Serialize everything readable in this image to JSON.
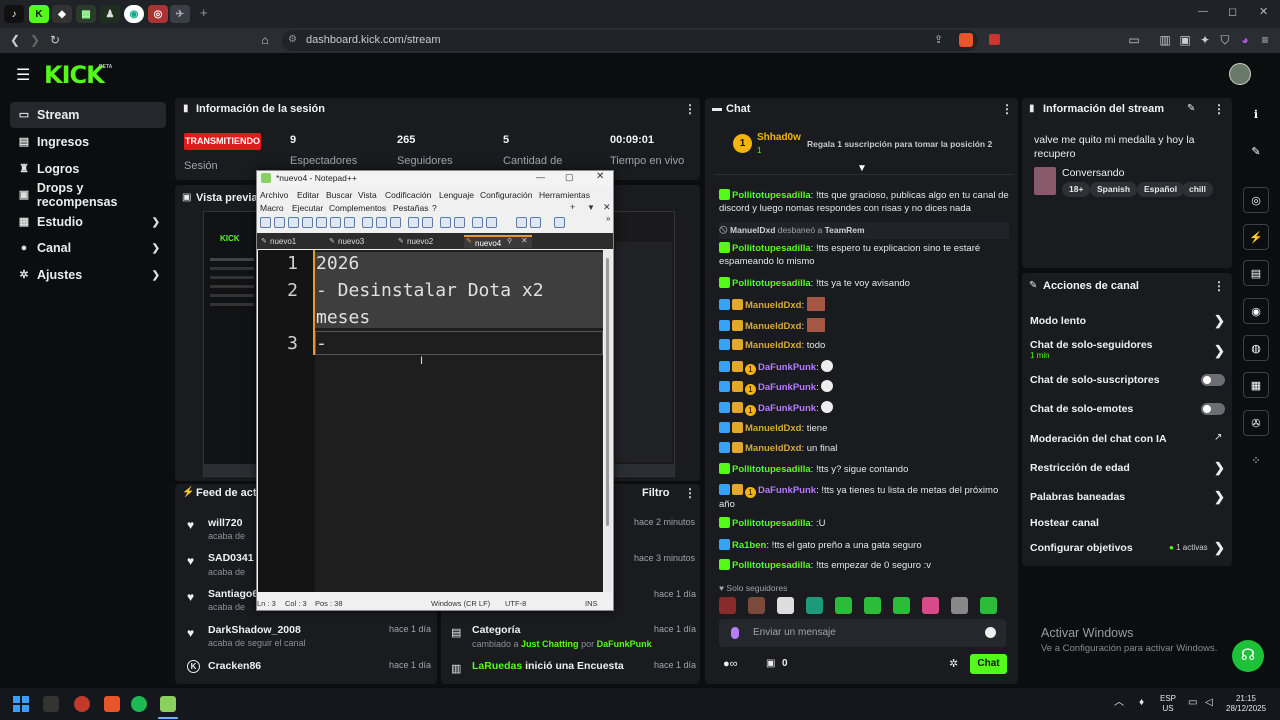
{
  "browser": {
    "url": "dashboard.kick.com/stream",
    "new_tab_glyph": "+"
  },
  "kick": {
    "logo": "KICK",
    "beta": "BETA"
  },
  "sidebar": {
    "items": [
      {
        "label": "Stream",
        "icon": "tv-icon",
        "glyph": "▭"
      },
      {
        "label": "Ingresos",
        "icon": "wallet-icon",
        "glyph": "▤"
      },
      {
        "label": "Logros",
        "icon": "trophy-icon",
        "glyph": "♜"
      },
      {
        "label": "Drops y recompensas",
        "icon": "gift-icon",
        "glyph": "▣"
      },
      {
        "label": "Estudio",
        "icon": "grid-icon",
        "glyph": "▦"
      },
      {
        "label": "Canal",
        "icon": "user-icon",
        "glyph": "●"
      },
      {
        "label": "Ajustes",
        "icon": "gear-icon",
        "glyph": "✲"
      }
    ]
  },
  "session": {
    "title": "Información de la sesión",
    "live_badge": "TRANSMITIENDO",
    "session_label": "Sesión",
    "viewers": "9",
    "viewers_label": "Espectadores",
    "followers": "265",
    "followers_label": "Seguidores",
    "amount": "5",
    "amount_label": "Cantidad de",
    "live_time": "00:09:01",
    "live_time_label": "Tiempo en vivo"
  },
  "preview": {
    "title": "Vista previa d"
  },
  "feed": {
    "title": "Feed de activ",
    "filter_label": "Filtro",
    "left": [
      {
        "user": "will720",
        "sub": "acaba de",
        "icon": "heart-icon",
        "glyph": "♥"
      },
      {
        "user": "SAD0341",
        "sub": "acaba de",
        "icon": "heart-icon",
        "glyph": "♥"
      },
      {
        "user": "Santiago6",
        "sub": "acaba de",
        "icon": "heart-icon",
        "glyph": "♥"
      },
      {
        "user": "DarkShadow_2008",
        "sub": "acaba de seguir el canal",
        "time": "hace 1 día",
        "icon": "heart-icon",
        "glyph": "♥"
      },
      {
        "user": "Cracken86",
        "sub": "",
        "time": "hace 1 día",
        "icon": "kick-icon",
        "glyph": "K"
      }
    ],
    "right_times": [
      "hace 2 minutos",
      "hace 3 minutos",
      "hace 1 día"
    ],
    "category": {
      "title": "Categoría",
      "prefix": "cambiado a",
      "game": "Just Chatting",
      "by_prefix": "por",
      "by": "DaFunkPunk",
      "time": "hace 1 día"
    },
    "poll": {
      "user": "LaRuedas",
      "text": "inició una Encuesta",
      "time": "hace 1 día"
    }
  },
  "chat": {
    "title": "Chat",
    "top_gifter": "Shhad0w",
    "top_rank": "1",
    "gift_prompt": "Regala 1 suscripción para tomar la posición 2",
    "messages": [
      {
        "user": "Pollitotupesadilla",
        "color": "green",
        "badges": [
          "green"
        ],
        "text": "!tts que gracioso, publicas algo en tu canal de discord y luego nomas respondes con risas y no dices nada"
      },
      {
        "system": true,
        "user": "ManuelDxd",
        "text": "desbaneó a",
        "target": "TeamRem"
      },
      {
        "user": "Pollitotupesadilla",
        "color": "green",
        "badges": [
          "green"
        ],
        "text": "!tts espero tu explicacion sino te estaré espameando lo mismo"
      },
      {
        "user": "Pollitotupesadilla",
        "color": "green",
        "badges": [
          "green"
        ],
        "text": "!tts ya te voy avisando"
      },
      {
        "user": "ManueldDxd",
        "color": "gold",
        "badges": [
          "mod",
          "vip"
        ],
        "text": "",
        "emote": true
      },
      {
        "user": "ManueldDxd",
        "color": "gold",
        "badges": [
          "mod",
          "vip"
        ],
        "text": "",
        "emote": true
      },
      {
        "user": "ManueldDxd",
        "color": "gold",
        "badges": [
          "mod",
          "vip"
        ],
        "text": "todo"
      },
      {
        "user": "DaFunkPunk",
        "color": "purple",
        "badges": [
          "mod",
          "vip",
          "sub"
        ],
        "text": "",
        "skull": true
      },
      {
        "user": "DaFunkPunk",
        "color": "purple",
        "badges": [
          "mod",
          "vip",
          "sub"
        ],
        "text": "",
        "skull": true
      },
      {
        "user": "DaFunkPunk",
        "color": "purple",
        "badges": [
          "mod",
          "vip",
          "sub"
        ],
        "text": "",
        "skull": true
      },
      {
        "user": "ManueldDxd",
        "color": "gold",
        "badges": [
          "mod",
          "vip"
        ],
        "text": "tiene"
      },
      {
        "user": "ManueldDxd",
        "color": "gold",
        "badges": [
          "mod",
          "vip"
        ],
        "text": "un final"
      },
      {
        "user": "Pollitotupesadilla",
        "color": "green",
        "badges": [
          "green"
        ],
        "text": "!tts y? sigue contando"
      },
      {
        "user": "DaFunkPunk",
        "color": "purple",
        "badges": [
          "mod",
          "vip",
          "sub"
        ],
        "text": "!tts ya tienes tu lista de metas del próximo año"
      },
      {
        "user": "Pollitotupesadilla",
        "color": "green",
        "badges": [
          "green"
        ],
        "text": ":U"
      },
      {
        "user": "Ra1ben",
        "color": "green",
        "badges": [
          "mod"
        ],
        "text": "!tts el gato preño a una gata seguro"
      },
      {
        "user": "Pollitotupesadilla",
        "color": "green",
        "badges": [
          "green"
        ],
        "text": "!tts empezar de 0 seguro :v"
      }
    ],
    "followers_only": "Solo seguidores",
    "input_placeholder": "Enviar un mensaje",
    "points": "0",
    "send_label": "Chat"
  },
  "stream_info": {
    "title": "Información del stream",
    "stream_title": "valve me quito mi medalla y hoy la recupero",
    "category": "Conversando",
    "tags": [
      "18+",
      "Spanish",
      "Español",
      "chill"
    ]
  },
  "actions": {
    "title": "Acciones de canal",
    "items": [
      {
        "label": "Modo lento",
        "type": "chevron"
      },
      {
        "label": "Chat de solo-seguidores",
        "sub": "1 min",
        "type": "chevron"
      },
      {
        "label": "Chat de solo-suscriptores",
        "type": "toggle"
      },
      {
        "label": "Chat de solo-emotes",
        "type": "toggle"
      },
      {
        "label": "Moderación del chat con IA",
        "type": "external"
      },
      {
        "label": "Restricción de edad",
        "type": "chevron"
      },
      {
        "label": "Palabras baneadas",
        "type": "chevron"
      },
      {
        "label": "Hostear canal",
        "type": "none"
      },
      {
        "label": "Configurar objetivos",
        "badge": "1 activas",
        "type": "chevron"
      }
    ]
  },
  "watermark": {
    "line1": "Activar Windows",
    "line2": "Ve a Configuración para activar Windows."
  },
  "notepad": {
    "title": "*nuevo4 - Notepad++",
    "menu": [
      "Archivo",
      "Editar",
      "Buscar",
      "Vista",
      "Codificación",
      "Lenguaje",
      "Configuración",
      "Herramientas",
      "Macro",
      "Ejecutar",
      "Complementos",
      "Pestañas",
      "?"
    ],
    "tabs": [
      "nuevo1",
      "nuevo3",
      "nuevo2",
      "nuevo4"
    ],
    "lines": [
      "2026",
      "- Desinstalar Dota x2",
      "meses",
      "-"
    ],
    "line_numbers": [
      "1",
      "2",
      "3"
    ],
    "status": {
      "ln": "Ln : 3",
      "col": "Col : 3",
      "pos": "Pos : 38",
      "eol": "Windows (CR LF)",
      "enc": "UTF-8",
      "mode": "INS"
    }
  },
  "taskbar": {
    "lang": "ESP",
    "region": "US",
    "time": "21:15",
    "date": "28/12/2025"
  },
  "colors": {
    "kick_green": "#53fc18",
    "live_red": "#e11a1a",
    "panel": "#191b1f",
    "bg": "#0b0e0f"
  }
}
